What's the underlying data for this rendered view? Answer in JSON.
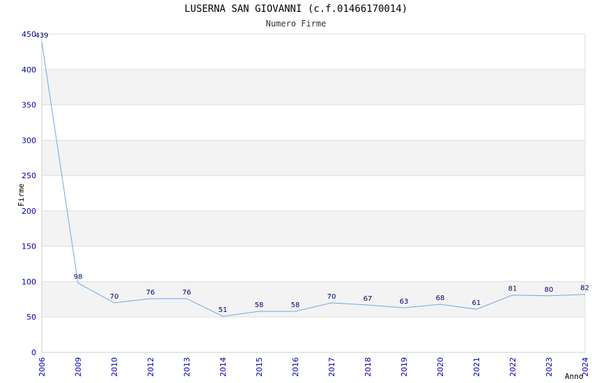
{
  "chart_data": {
    "type": "line",
    "title": "LUSERNA SAN GIOVANNI (c.f.01466170014)",
    "subtitle": "Numero Firme",
    "xlabel": "Anno",
    "ylabel": "Firme",
    "ylim": [
      0,
      450
    ],
    "yticks": [
      "0",
      "50",
      "100",
      "150",
      "200",
      "250",
      "300",
      "350",
      "400",
      "450"
    ],
    "categories": [
      "2006",
      "2009",
      "2010",
      "2012",
      "2013",
      "2014",
      "2015",
      "2016",
      "2017",
      "2018",
      "2019",
      "2020",
      "2021",
      "2022",
      "2023",
      "2024"
    ],
    "values": [
      439,
      98,
      70,
      76,
      76,
      51,
      58,
      58,
      70,
      67,
      63,
      68,
      61,
      81,
      80,
      82
    ],
    "grid": true,
    "line_color": "#6aa8e8"
  }
}
